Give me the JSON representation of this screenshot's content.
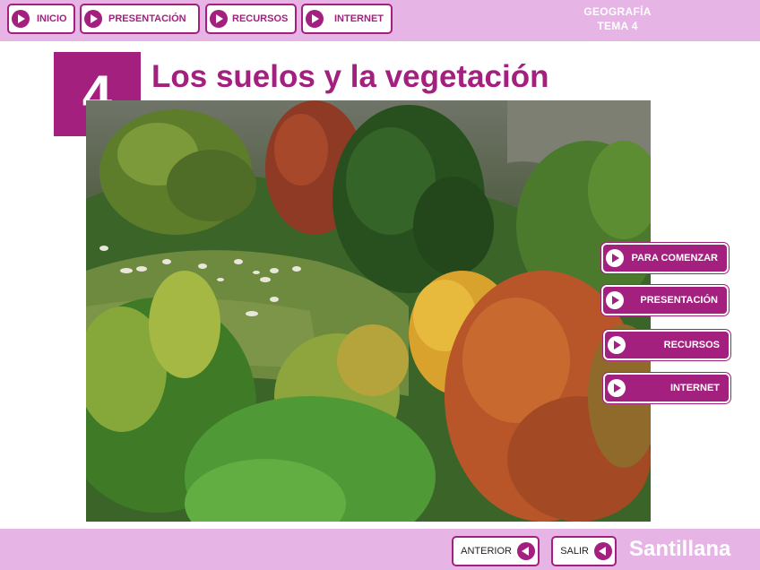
{
  "colors": {
    "accent": "#a3207f",
    "bar_background": "#e6b5e6",
    "white": "#ffffff"
  },
  "top_nav": {
    "items": [
      {
        "label": "INICIO",
        "icon": "play-arrow-icon"
      },
      {
        "label": "PRESENTACIÓN",
        "icon": "play-arrow-icon"
      },
      {
        "label": "RECURSOS",
        "icon": "play-arrow-icon"
      },
      {
        "label": "INTERNET",
        "icon": "play-arrow-icon"
      }
    ]
  },
  "subject": {
    "line1": "GEOGRAFÍA",
    "line2": "TEMA 4"
  },
  "unit": {
    "number": "4",
    "title": "Los suelos y la vegetación"
  },
  "photo": {
    "icon": "landscape-photo"
  },
  "side_menu": {
    "items": [
      {
        "label": "PARA COMENZAR",
        "icon": "play-arrow-icon"
      },
      {
        "label": "PRESENTACIÓN",
        "icon": "play-arrow-icon"
      },
      {
        "label": "RECURSOS",
        "icon": "play-arrow-icon"
      },
      {
        "label": "INTERNET",
        "icon": "play-arrow-icon"
      }
    ]
  },
  "footer": {
    "previous_label": "ANTERIOR",
    "exit_label": "SALIR",
    "brand": "Santillana",
    "back_icon": "back-arrow-icon"
  }
}
